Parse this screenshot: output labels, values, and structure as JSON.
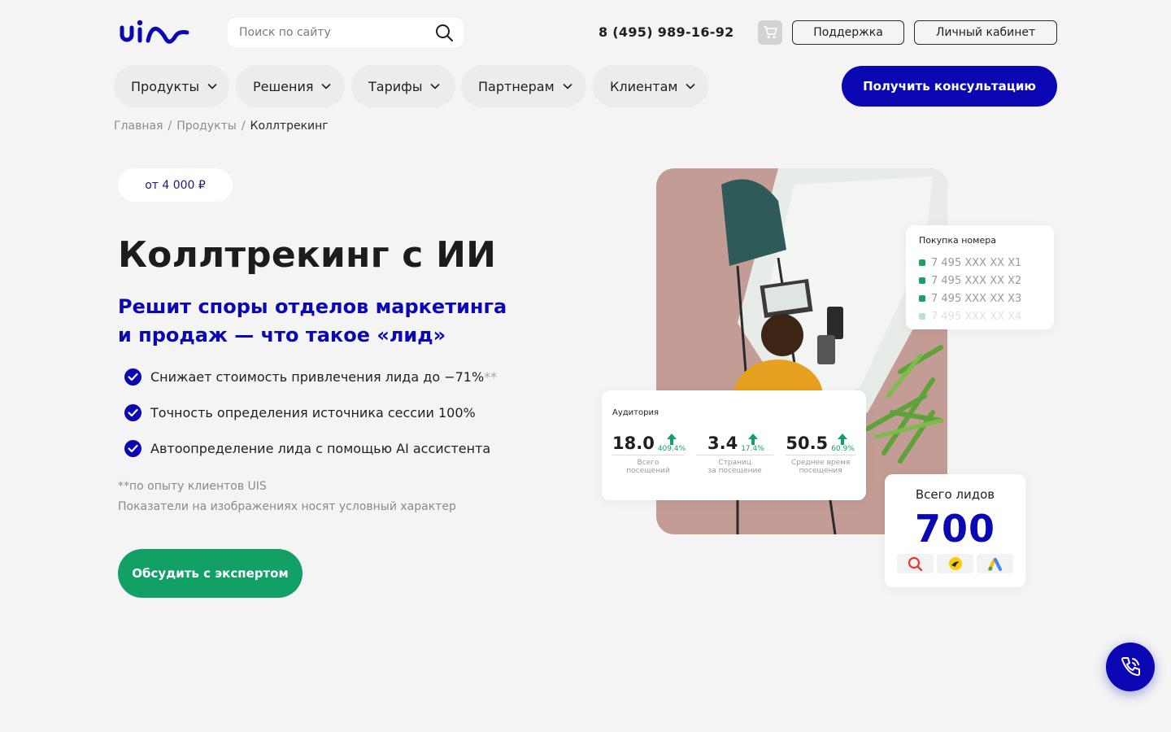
{
  "header": {
    "search_placeholder": "Поиск по сайту",
    "phone": "8 (495) 989-16-92",
    "support_label": "Поддержка",
    "cabinet_label": "Личный кабинет"
  },
  "nav": {
    "items": [
      {
        "label": "Продукты"
      },
      {
        "label": "Решения"
      },
      {
        "label": "Тарифы"
      },
      {
        "label": "Партнерам"
      },
      {
        "label": "Клиентам"
      }
    ],
    "consult_label": "Получить консультацию"
  },
  "breadcrumbs": {
    "home": "Главная",
    "sep": "/",
    "products": "Продукты",
    "current": "Коллтрекинг"
  },
  "hero": {
    "price": "от 4 000 ₽",
    "title": "Коллтрекинг с ИИ",
    "subtitle_line1": "Решит споры отделов маркетинга",
    "subtitle_line2": "и продаж — что такое «лид»",
    "bullets": [
      {
        "text": "Снижает стоимость привлечения лида до −71%",
        "mark": "**"
      },
      {
        "text": "Точность определения источника сессии 100%"
      },
      {
        "text": "Автоопределение лида с помощью AI ассистента"
      }
    ],
    "note1": "**по опыту клиентов UIS",
    "note2": "Показатели на изображениях носят условный характер",
    "cta_label": "Обсудить с экспертом"
  },
  "cards": {
    "buy_title": "Покупка номера",
    "numbers": [
      "7 495 XXX XX X1",
      "7 495 XXX XX X2",
      "7 495 XXX XX X3",
      "7 495 XXX XX X4"
    ],
    "audience_title": "Аудитория",
    "metrics": [
      {
        "value": "18.0",
        "change": "409.4%",
        "label1": "Всего",
        "label2": "посещений"
      },
      {
        "value": "3.4",
        "change": "17.4%",
        "label1": "Страниц",
        "label2": "за посещение"
      },
      {
        "value": "50.5",
        "change": "60.9%",
        "label1": "Среднее время",
        "label2": "посещения"
      }
    ],
    "leads_title": "Всего лидов",
    "leads_value": "700"
  },
  "colors": {
    "brand": "#0b08b3",
    "accent_green": "#12a067",
    "background": "#f4f4f4"
  },
  "icons": [
    "logo-uis",
    "search-icon",
    "cart-icon",
    "chevron-down-icon",
    "check-circle-icon",
    "arrow-up-icon",
    "yandex-search-icon",
    "yandex-direct-icon",
    "google-ads-icon",
    "phone-call-icon"
  ]
}
